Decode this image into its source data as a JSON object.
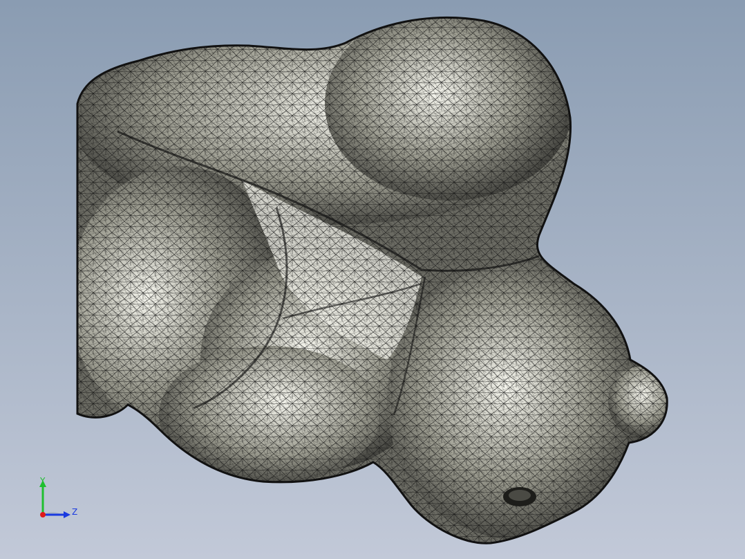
{
  "viewport": {
    "background_top": "#8a9cb2",
    "background_bottom": "#c2c9d8"
  },
  "model": {
    "name": "mesh-model",
    "shade_dark": "#3a3a36",
    "shade_mid": "#9a9a8e",
    "shade_light": "#f4f4ec",
    "edge_color": "#111111"
  },
  "triad": {
    "y_label": "Y",
    "z_label": "Z",
    "y_color": "#1fbf2f",
    "z_color": "#1a3ae0",
    "x_color": "#e01a1a"
  }
}
